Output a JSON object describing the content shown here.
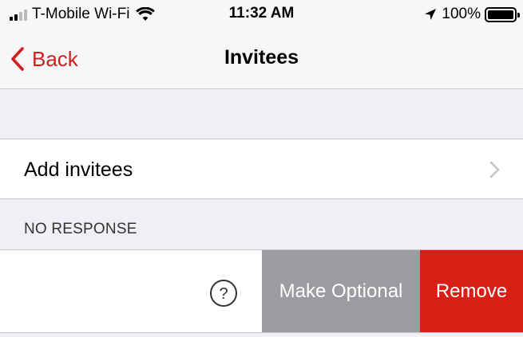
{
  "status_bar": {
    "carrier": "T-Mobile Wi-Fi",
    "time": "11:32 AM",
    "battery": "100%",
    "icons": [
      "signal-icon",
      "wifi-icon",
      "location-arrow-icon",
      "battery-icon"
    ]
  },
  "nav": {
    "back_label": "Back",
    "title": "Invitees"
  },
  "add_row": {
    "label": "Add invitees"
  },
  "section": {
    "header": "NO RESPONSE"
  },
  "invitee_row": {
    "status_icon": "question-circle-icon",
    "actions": {
      "optional_label": "Make Optional",
      "remove_label": "Remove"
    }
  },
  "colors": {
    "accent": "#d11f1f",
    "remove": "#d81f16",
    "optional": "#9c9ba0",
    "background": "#efeff4"
  }
}
